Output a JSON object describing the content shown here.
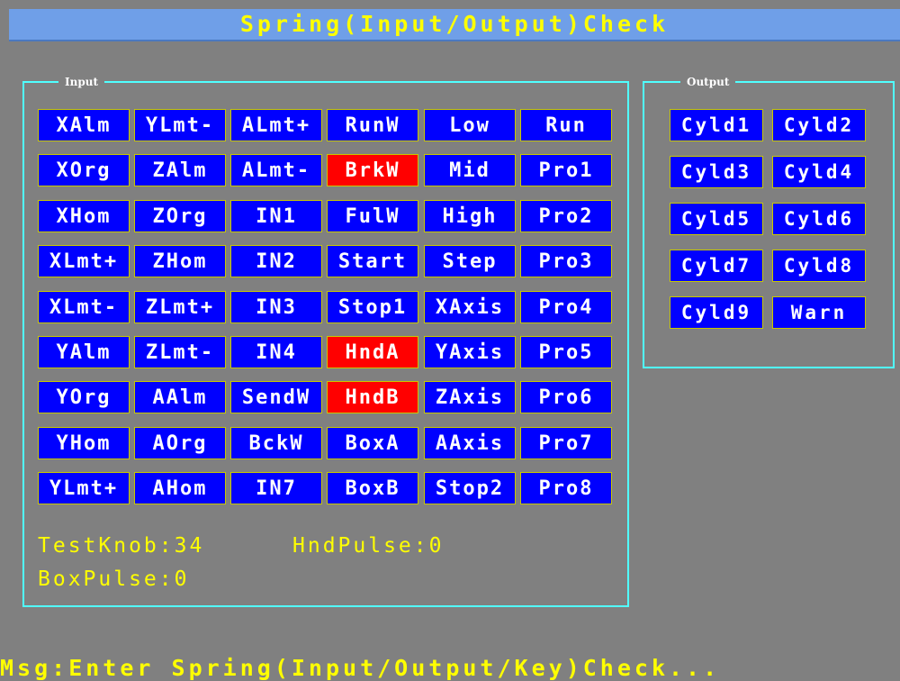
{
  "title": "Spring(Input/Output)Check",
  "input_group": {
    "label": "Input",
    "columns": [
      [
        {
          "label": "XAlm",
          "active": false
        },
        {
          "label": "XOrg",
          "active": false
        },
        {
          "label": "XHom",
          "active": false
        },
        {
          "label": "XLmt+",
          "active": false
        },
        {
          "label": "XLmt-",
          "active": false
        },
        {
          "label": "YAlm",
          "active": false
        },
        {
          "label": "YOrg",
          "active": false
        },
        {
          "label": "YHom",
          "active": false
        },
        {
          "label": "YLmt+",
          "active": false
        }
      ],
      [
        {
          "label": "YLmt-",
          "active": false
        },
        {
          "label": "ZAlm",
          "active": false
        },
        {
          "label": "ZOrg",
          "active": false
        },
        {
          "label": "ZHom",
          "active": false
        },
        {
          "label": "ZLmt+",
          "active": false
        },
        {
          "label": "ZLmt-",
          "active": false
        },
        {
          "label": "AAlm",
          "active": false
        },
        {
          "label": "AOrg",
          "active": false
        },
        {
          "label": "AHom",
          "active": false
        }
      ],
      [
        {
          "label": "ALmt+",
          "active": false
        },
        {
          "label": "ALmt-",
          "active": false
        },
        {
          "label": "IN1",
          "active": false
        },
        {
          "label": "IN2",
          "active": false
        },
        {
          "label": "IN3",
          "active": false
        },
        {
          "label": "IN4",
          "active": false
        },
        {
          "label": "SendW",
          "active": false
        },
        {
          "label": "BckW",
          "active": false
        },
        {
          "label": "IN7",
          "active": false
        }
      ],
      [
        {
          "label": "RunW",
          "active": false
        },
        {
          "label": "BrkW",
          "active": true
        },
        {
          "label": "FulW",
          "active": false
        },
        {
          "label": "Start",
          "active": false
        },
        {
          "label": "Stop1",
          "active": false
        },
        {
          "label": "HndA",
          "active": true
        },
        {
          "label": "HndB",
          "active": true
        },
        {
          "label": "BoxA",
          "active": false
        },
        {
          "label": "BoxB",
          "active": false
        }
      ],
      [
        {
          "label": "Low",
          "active": false
        },
        {
          "label": "Mid",
          "active": false
        },
        {
          "label": "High",
          "active": false
        },
        {
          "label": "Step",
          "active": false
        },
        {
          "label": "XAxis",
          "active": false
        },
        {
          "label": "YAxis",
          "active": false
        },
        {
          "label": "ZAxis",
          "active": false
        },
        {
          "label": "AAxis",
          "active": false
        },
        {
          "label": "Stop2",
          "active": false
        }
      ],
      [
        {
          "label": "Run",
          "active": false
        },
        {
          "label": "Pro1",
          "active": false
        },
        {
          "label": "Pro2",
          "active": false
        },
        {
          "label": "Pro3",
          "active": false
        },
        {
          "label": "Pro4",
          "active": false
        },
        {
          "label": "Pro5",
          "active": false
        },
        {
          "label": "Pro6",
          "active": false
        },
        {
          "label": "Pro7",
          "active": false
        },
        {
          "label": "Pro8",
          "active": false
        }
      ]
    ],
    "test_knob": "TestKnob:34",
    "hnd_pulse": "HndPulse:0",
    "box_pulse": "BoxPulse:0"
  },
  "output_group": {
    "label": "Output",
    "columns": [
      [
        {
          "label": "Cyld1",
          "active": false
        },
        {
          "label": "Cyld3",
          "active": false
        },
        {
          "label": "Cyld5",
          "active": false
        },
        {
          "label": "Cyld7",
          "active": false
        },
        {
          "label": "Cyld9",
          "active": false
        }
      ],
      [
        {
          "label": "Cyld2",
          "active": false
        },
        {
          "label": "Cyld4",
          "active": false
        },
        {
          "label": "Cyld6",
          "active": false
        },
        {
          "label": "Cyld8",
          "active": false
        },
        {
          "label": "Warn",
          "active": false
        }
      ]
    ]
  },
  "message": "Msg:Enter Spring(Input/Output/Key)Check...",
  "colors": {
    "indicator_off": "#0000ff",
    "indicator_on": "#ff0000",
    "frame": "#50ffff",
    "text_highlight": "#ffff00"
  }
}
